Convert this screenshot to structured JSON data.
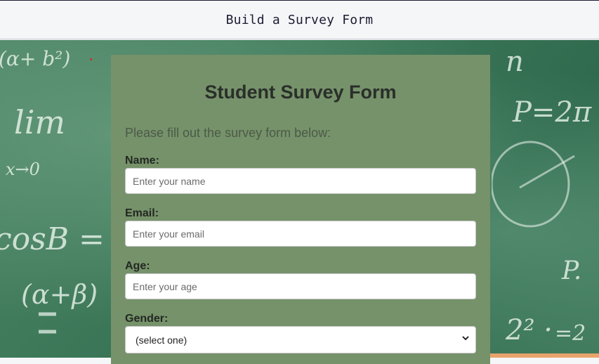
{
  "header": {
    "title": "Build a Survey Form"
  },
  "form": {
    "title": "Student Survey Form",
    "intro": "Please fill out the survey form below:",
    "fields": {
      "name": {
        "label": "Name:",
        "placeholder": "Enter your name",
        "value": ""
      },
      "email": {
        "label": "Email:",
        "placeholder": "Enter your email",
        "value": ""
      },
      "age": {
        "label": "Age:",
        "placeholder": "Enter your age",
        "value": ""
      },
      "gender": {
        "label": "Gender:",
        "options": [
          "(select one)"
        ],
        "selected": "(select one)"
      }
    }
  },
  "background": {
    "chalk": [
      "(α+ b²)",
      "lim",
      "x→0",
      "cosB =",
      "(α+β)",
      "P=2π",
      "P.",
      "n",
      "2² ·",
      "=2"
    ]
  },
  "colors": {
    "card_bg": "#76926a",
    "board_green": "#3f7a5b",
    "topbar_bg": "#f5f6f8"
  }
}
